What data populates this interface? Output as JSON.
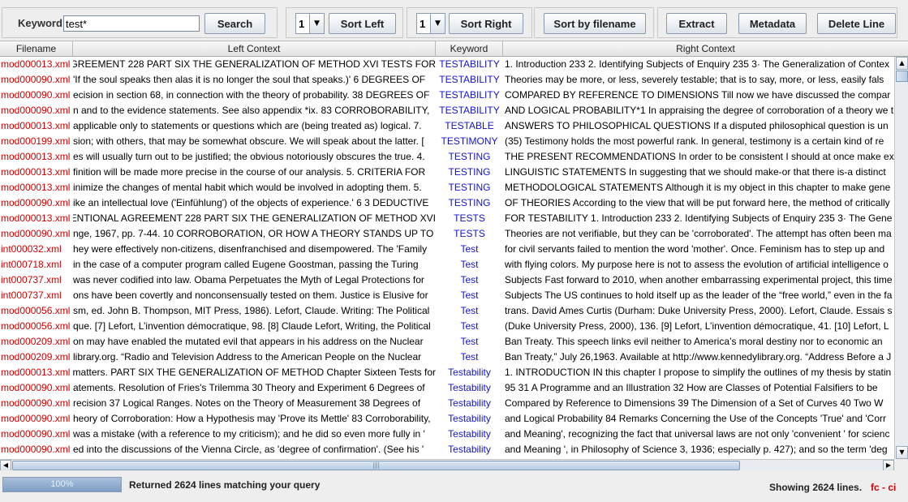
{
  "toolbar": {
    "keyword_label": "Keyword",
    "keyword_value": "test*",
    "search_label": "Search",
    "sort_left_value": "1",
    "sort_left_label": "Sort Left",
    "sort_right_value": "1",
    "sort_right_label": "Sort Right",
    "sort_filename_label": "Sort by filename",
    "extract_label": "Extract",
    "metadata_label": "Metadata",
    "delete_line_label": "Delete Line"
  },
  "table": {
    "columns": [
      "Filename",
      "Left Context",
      "Keyword",
      "Right Context"
    ],
    "rows": [
      {
        "file": "mod000013.xml",
        "left": "GREEMENT 228 PART SIX THE GENERALIZATION OF METHOD XVI TESTS FOR",
        "kw": "TESTABILITY",
        "right": "1. Introduction 233 2. Identifying Subjects of Enquiry 235 3· The Generalization of Contex"
      },
      {
        "file": "mod000090.xml",
        "left": "'If the soul speaks then alas it is no longer the soul that speaks.)' 6 DEGREES OF",
        "kw": "TESTABILITY",
        "right": "Theories may be more, or less, severely testable; that is to say, more, or less, easily fals"
      },
      {
        "file": "mod000090.xml",
        "left": "ecision in section 68, in connection with the theory of probability. 38 DEGREES OF",
        "kw": "TESTABILITY",
        "right": "COMPARED BY REFERENCE TO DIMENSIONS Till now we have discussed the compar"
      },
      {
        "file": "mod000090.xml",
        "left": "n and to the evidence statements. See also appendix *ix. 83 CORROBORABILITY,",
        "kw": "TESTABILITY",
        "right": "AND LOGICAL PROBABILITY*1 In appraising the degree of corroboration of a theory we t"
      },
      {
        "file": "mod000013.xml",
        "left": "applicable only to statements or questions which are (being treated as) logical. 7.",
        "kw": "TESTABLE",
        "right": "ANSWERS TO PHILOSOPHICAL QUESTIONS If a disputed philosophical question is un"
      },
      {
        "file": "mod000199.xml",
        "left": "sion; with others, that may be somewhat obscure. We will speak about the latter. [",
        "kw": "TESTIMONY",
        "right": "(35) Testimony holds the most powerful rank. In general, testimony is a certain kind of re"
      },
      {
        "file": "mod000013.xml",
        "left": "es will usually turn out to be justified; the obvious notoriously obscures the true. 4.",
        "kw": "TESTING",
        "right": "THE PRESENT RECOMMENDATIONS In order to be consistent I should at once make ex"
      },
      {
        "file": "mod000013.xml",
        "left": "finition will be made more precise in the course of our analysis. 5. CRITERIA FOR",
        "kw": "TESTING",
        "right": "LINGUISTIC STATEMENTS In suggesting that we should make-or that there is-a distinct"
      },
      {
        "file": "mod000013.xml",
        "left": "inimize the changes of mental habit which would be involved in adopting them. 5.",
        "kw": "TESTING",
        "right": "METHODOLOGICAL STATEMENTS Although it is my object in this chapter to make gene"
      },
      {
        "file": "mod000090.xml",
        "left": "ike an intellectual love ('Einfühlung') of the objects of experience.' 6 3 DEDUCTIVE",
        "kw": "TESTING",
        "right": "OF THEORIES According to the view that will be put forward here, the method of critically"
      },
      {
        "file": "mod000013.xml",
        "left": "/ENTIONAL AGREEMENT 228 PART SIX THE GENERALIZATION OF METHOD XVI",
        "kw": "TESTS",
        "right": "FOR TESTABILITY 1. Introduction 233 2. Identifying Subjects of Enquiry 235 3· The Gene"
      },
      {
        "file": "mod000090.xml",
        "left": "nge, 1967, pp. 7-44. 10 CORROBORATION, OR HOW A THEORY STANDS UP TO",
        "kw": "TESTS",
        "right": "Theories are not verifiable, but they can be 'corroborated'. The attempt has often been ma"
      },
      {
        "file": "int000032.xml",
        "left": "hey were effectively non-citizens, disenfranchised and disempowered. The 'Family",
        "kw": "Test",
        "right": "for civil servants failed to mention the word 'mother'. Once. Feminism has to step up and"
      },
      {
        "file": "int000718.xml",
        "left": "in the case of a computer program called Eugene Goostman, passing the Turing",
        "kw": "Test",
        "right": "with flying colors. My purpose here is not to assess the evolution of artificial intelligence o"
      },
      {
        "file": "int000737.xml",
        "left": "was never codified into law. Obama Perpetuates the Myth of Legal Protections for",
        "kw": "Test",
        "right": "Subjects Fast forward to 2010, when another embarrassing experimental project, this time"
      },
      {
        "file": "int000737.xml",
        "left": "ons have been covertly and nonconsensually tested on them. Justice is Elusive for",
        "kw": "Test",
        "right": "Subjects The US continues to hold itself up as the leader of the “free world,” even in the fa"
      },
      {
        "file": "mod000056.xml",
        "left": "sm, ed. John B. Thompson, MIT Press, 1986). Lefort, Claude. Writing: The Political",
        "kw": "Test",
        "right": "trans. David Ames Curtis (Durham: Duke University Press, 2000). Lefort, Claude. Essais s"
      },
      {
        "file": "mod000056.xml",
        "left": "que. [7] Lefort, L’invention démocratique, 98. [8] Claude Lefort, Writing, the Political",
        "kw": "Test",
        "right": "(Duke University Press, 2000), 136. [9] Lefort, L’invention démocratique, 41. [10] Lefort, L"
      },
      {
        "file": "mod000209.xml",
        "left": "on may have enabled the mutated evil that appears in his address on the Nuclear",
        "kw": "Test",
        "right": "Ban Treaty. This speech links evil neither to America’s moral destiny nor to economic an"
      },
      {
        "file": "mod000209.xml",
        "left": "library.org. “Radio and Television Address to the American People on the Nuclear",
        "kw": "Test",
        "right": "Ban Treaty,” July 26,1963. Available at http://www.kennedylibrary.org. “Address Before a J"
      },
      {
        "file": "mod000013.xml",
        "left": "matters. PART SIX THE GENERALIZATION OF METHOD Chapter Sixteen Tests for",
        "kw": "Testability",
        "right": "1. INTRODUCTION IN this chapter I propose to simplify the outlines of my thesis by statin"
      },
      {
        "file": "mod000090.xml",
        "left": "atements. Resolution of Fries's Trilemma 30 Theory and Experiment 6 Degrees of",
        "kw": "Testability",
        "right": "95 31 A Programme and an Illustration 32 How are Classes of Potential Falsifiers to be"
      },
      {
        "file": "mod000090.xml",
        "left": "recision 37 Logical Ranges. Notes on the Theory of Measurement 38 Degrees of",
        "kw": "Testability",
        "right": "Compared by Reference to Dimensions 39 The Dimension of a Set of Curves 40 Two W"
      },
      {
        "file": "mod000090.xml",
        "left": "heory of Corroboration: How a Hypothesis may 'Prove its Mettle' 83 Corroborability,",
        "kw": "Testability",
        "right": "and Logical Probability 84 Remarks Concerning the Use of the Concepts 'True' and 'Corr"
      },
      {
        "file": "mod000090.xml",
        "left": "was a mistake (with a reference to my criticism); and he did so even more fully in '",
        "kw": "Testability",
        "right": "and Meaning', recognizing the fact that universal laws are not only 'convenient ' for scienc"
      },
      {
        "file": "mod000090.xml",
        "left": "ed into the discussions of the Vienna Circle, as 'degree of confirmation'. (See his '",
        "kw": "Testability",
        "right": "and Meaning ', in Philosophy of Science 3, 1936; especially p. 427); and so the term 'deg"
      }
    ]
  },
  "status": {
    "progress_text": "100%",
    "progress_value": 1.0,
    "message": "Returned 2624 lines matching your query",
    "showing": "Showing 2624 lines.",
    "fc_ci": "fc - ci"
  },
  "colors": {
    "filename": "#d00000",
    "keyword": "#1414c8",
    "fc_ci": "#d00000"
  }
}
